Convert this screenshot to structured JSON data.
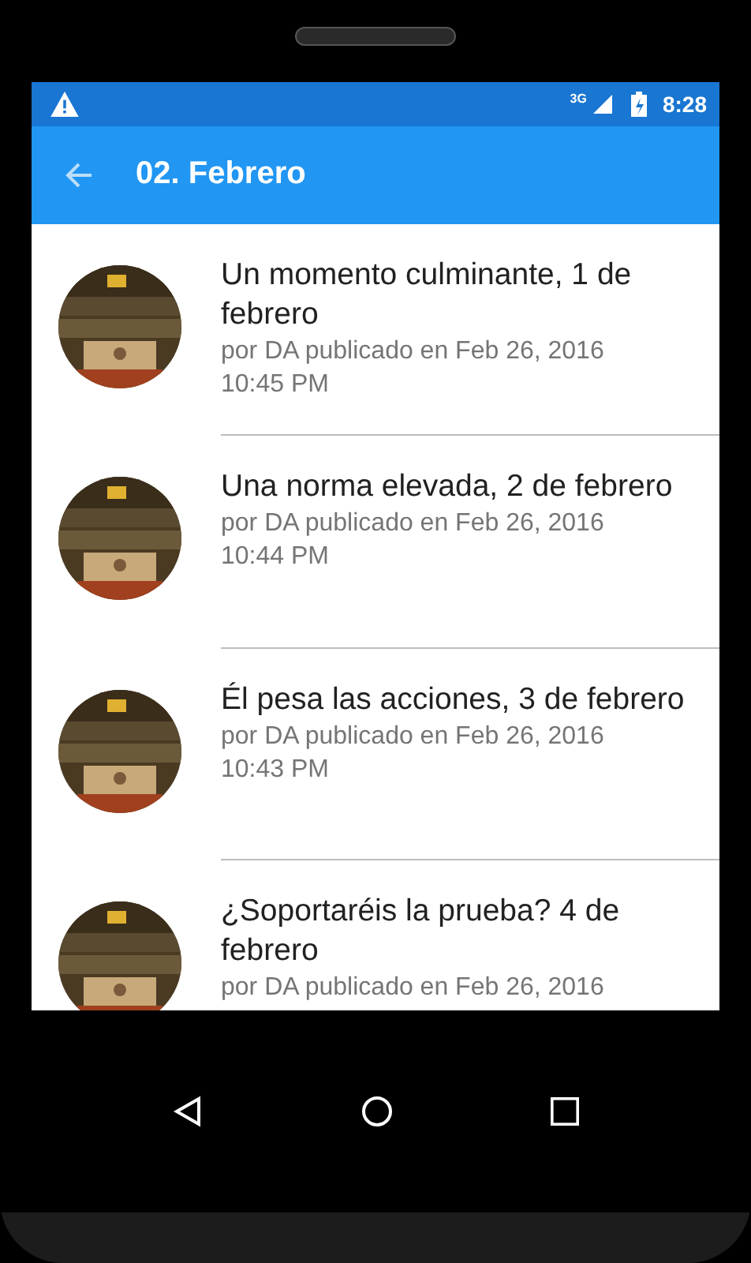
{
  "status_bar": {
    "network": "3G",
    "time": "8:28"
  },
  "app_bar": {
    "title": "02. Febrero"
  },
  "items": [
    {
      "title": "Un momento culminante, 1 de febrero",
      "meta": "por DA publicado en  Feb 26, 2016",
      "time": "10:45 PM"
    },
    {
      "title": "Una norma elevada, 2 de febrero",
      "meta": "por DA publicado en  Feb 26, 2016",
      "time": "10:44 PM"
    },
    {
      "title": "Él pesa las acciones, 3 de febrero",
      "meta": "por DA publicado en  Feb 26, 2016",
      "time": "10:43 PM"
    },
    {
      "title": "¿Soportaréis la prueba? 4 de febrero",
      "meta": "por DA publicado en  Feb 26, 2016"
    }
  ]
}
